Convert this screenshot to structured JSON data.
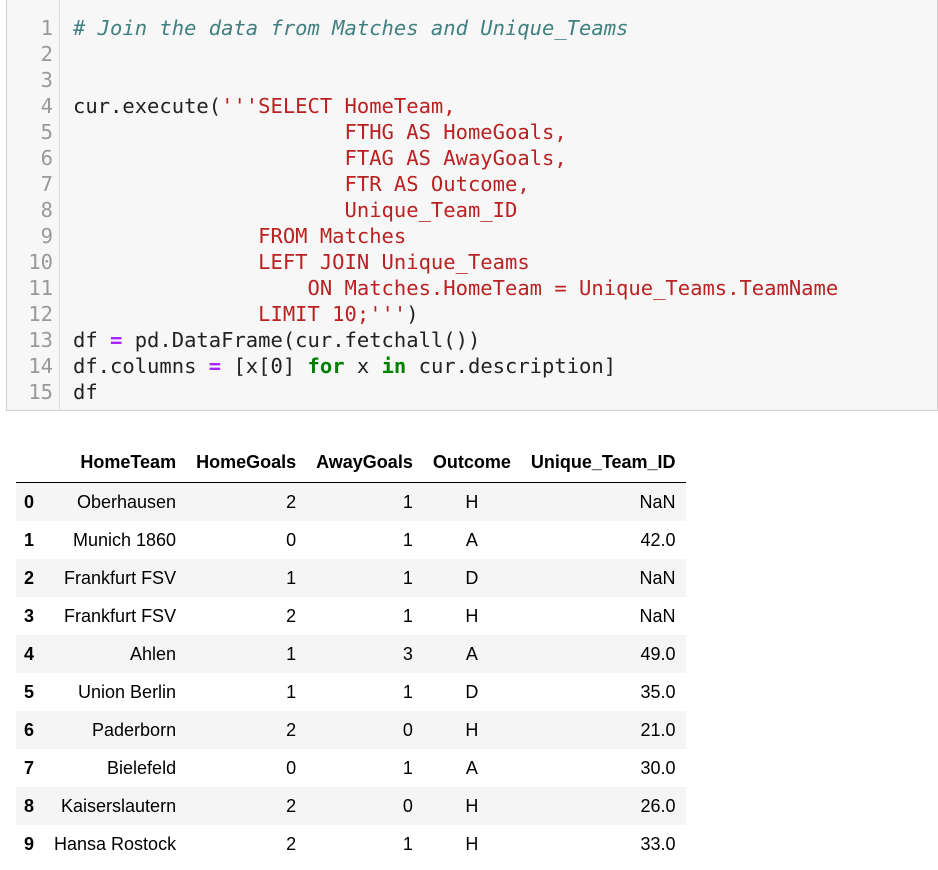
{
  "code_cell": {
    "lines": [
      {
        "n": "1",
        "parts": [
          {
            "t": "# Join the data from Matches and Unique_Teams",
            "c": "c-comment"
          }
        ]
      },
      {
        "n": "2",
        "parts": []
      },
      {
        "n": "3",
        "parts": []
      },
      {
        "n": "4",
        "parts": [
          {
            "t": "cur.execute(",
            "c": ""
          },
          {
            "t": "'''SELECT HomeTeam,",
            "c": "c-str"
          }
        ]
      },
      {
        "n": "5",
        "parts": [
          {
            "t": "                      FTHG AS HomeGoals,",
            "c": "c-str"
          }
        ]
      },
      {
        "n": "6",
        "parts": [
          {
            "t": "                      FTAG AS AwayGoals,",
            "c": "c-str"
          }
        ]
      },
      {
        "n": "7",
        "parts": [
          {
            "t": "                      FTR AS Outcome,",
            "c": "c-str"
          }
        ]
      },
      {
        "n": "8",
        "parts": [
          {
            "t": "                      Unique_Team_ID",
            "c": "c-str"
          }
        ]
      },
      {
        "n": "9",
        "parts": [
          {
            "t": "               FROM Matches",
            "c": "c-str"
          }
        ]
      },
      {
        "n": "10",
        "parts": [
          {
            "t": "               LEFT JOIN Unique_Teams",
            "c": "c-str"
          }
        ]
      },
      {
        "n": "11",
        "parts": [
          {
            "t": "                   ON Matches.HomeTeam = Unique_Teams.TeamName",
            "c": "c-str"
          }
        ]
      },
      {
        "n": "12",
        "parts": [
          {
            "t": "               LIMIT 10;'''",
            "c": "c-str"
          },
          {
            "t": ")",
            "c": ""
          }
        ]
      },
      {
        "n": "13",
        "parts": [
          {
            "t": "df ",
            "c": ""
          },
          {
            "t": "=",
            "c": "c-op"
          },
          {
            "t": " pd.DataFrame(cur.fetchall())",
            "c": ""
          }
        ]
      },
      {
        "n": "14",
        "parts": [
          {
            "t": "df.columns ",
            "c": ""
          },
          {
            "t": "=",
            "c": "c-op"
          },
          {
            "t": " [x[0] ",
            "c": ""
          },
          {
            "t": "for",
            "c": "c-kw"
          },
          {
            "t": " x ",
            "c": ""
          },
          {
            "t": "in",
            "c": "c-kw"
          },
          {
            "t": " cur.description]",
            "c": ""
          }
        ]
      },
      {
        "n": "15",
        "parts": [
          {
            "t": "df",
            "c": ""
          }
        ]
      }
    ]
  },
  "dataframe": {
    "columns": [
      "",
      "HomeTeam",
      "HomeGoals",
      "AwayGoals",
      "Outcome",
      "Unique_Team_ID"
    ],
    "rows": [
      [
        "0",
        "Oberhausen",
        "2",
        "1",
        "H",
        "NaN"
      ],
      [
        "1",
        "Munich 1860",
        "0",
        "1",
        "A",
        "42.0"
      ],
      [
        "2",
        "Frankfurt FSV",
        "1",
        "1",
        "D",
        "NaN"
      ],
      [
        "3",
        "Frankfurt FSV",
        "2",
        "1",
        "H",
        "NaN"
      ],
      [
        "4",
        "Ahlen",
        "1",
        "3",
        "A",
        "49.0"
      ],
      [
        "5",
        "Union Berlin",
        "1",
        "1",
        "D",
        "35.0"
      ],
      [
        "6",
        "Paderborn",
        "2",
        "0",
        "H",
        "21.0"
      ],
      [
        "7",
        "Bielefeld",
        "0",
        "1",
        "A",
        "30.0"
      ],
      [
        "8",
        "Kaiserslautern",
        "2",
        "0",
        "H",
        "26.0"
      ],
      [
        "9",
        "Hansa Rostock",
        "2",
        "1",
        "H",
        "33.0"
      ]
    ]
  },
  "colors": {
    "string": "#ba2121",
    "comment": "#408080",
    "keyword": "#008000",
    "operator": "#aa22ff",
    "stripe": "#f5f5f5"
  }
}
